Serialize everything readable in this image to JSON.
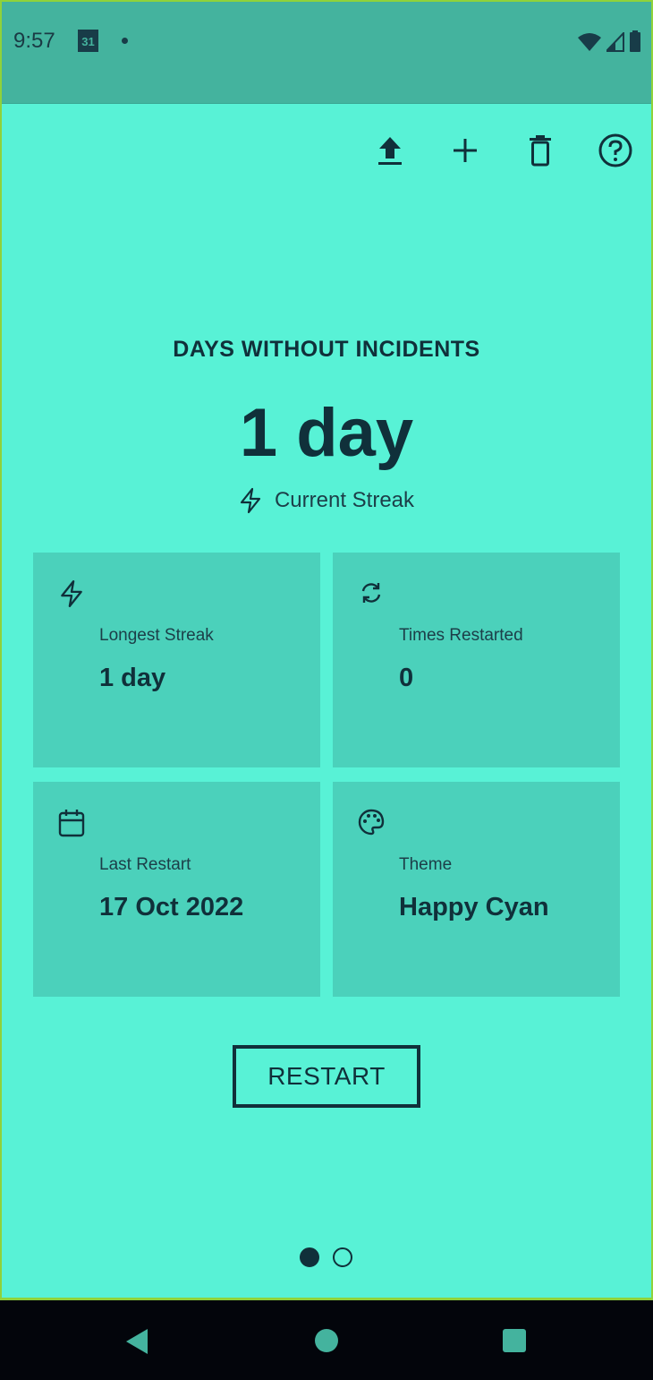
{
  "status_bar": {
    "time": "9:57",
    "calendar_day": "31"
  },
  "toolbar": {
    "icons": [
      "upload-icon",
      "add-icon",
      "delete-icon",
      "help-icon"
    ]
  },
  "main": {
    "heading": "DAYS WITHOUT INCIDENTS",
    "streak_value": "1 day",
    "streak_label": "Current Streak",
    "cards": [
      {
        "label": "Longest Streak",
        "value": "1 day",
        "icon": "lightning-icon"
      },
      {
        "label": "Times Restarted",
        "value": "0",
        "icon": "refresh-icon"
      },
      {
        "label": "Last Restart",
        "value": "17 Oct 2022",
        "icon": "calendar-icon"
      },
      {
        "label": "Theme",
        "value": "Happy Cyan",
        "icon": "palette-icon"
      }
    ],
    "restart_label": "RESTART",
    "pager": {
      "pages": 2,
      "current": 1
    }
  },
  "colors": {
    "background": "#58f2d6",
    "status_bar": "#44b39e",
    "card": "#4bd1bb",
    "text": "#10303a"
  }
}
